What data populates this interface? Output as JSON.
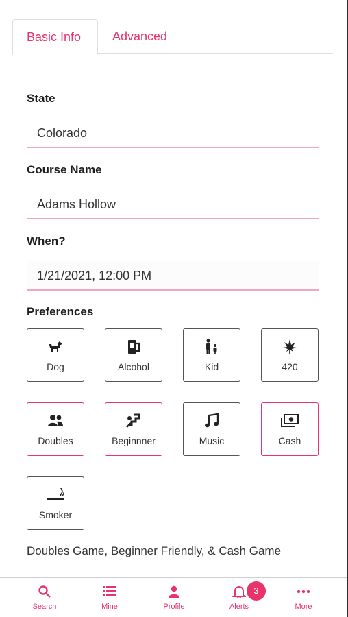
{
  "tabs": [
    {
      "label": "Basic Info",
      "active": true
    },
    {
      "label": "Advanced",
      "active": false
    }
  ],
  "form": {
    "state": {
      "label": "State",
      "value": "Colorado"
    },
    "course": {
      "label": "Course Name",
      "value": "Adams Hollow"
    },
    "when": {
      "label": "When?",
      "value": "1/21/2021, 12:00 PM"
    }
  },
  "preferences": {
    "label": "Preferences",
    "items": [
      {
        "label": "Dog",
        "icon": "dog-icon",
        "selected": false
      },
      {
        "label": "Alcohol",
        "icon": "alcohol-icon",
        "selected": false
      },
      {
        "label": "Kid",
        "icon": "kid-icon",
        "selected": false
      },
      {
        "label": "420",
        "icon": "cannabis-leaf-icon",
        "selected": false
      },
      {
        "label": "Doubles",
        "icon": "doubles-icon",
        "selected": true
      },
      {
        "label": "Beginnner",
        "icon": "beginner-icon",
        "selected": true
      },
      {
        "label": "Music",
        "icon": "music-icon",
        "selected": false
      },
      {
        "label": "Cash",
        "icon": "cash-icon",
        "selected": true
      },
      {
        "label": "Smoker",
        "icon": "smoking-icon",
        "selected": false
      }
    ],
    "summary": "Doubles Game, Beginner Friendly, & Cash Game"
  },
  "bottom_nav": [
    {
      "label": "Search",
      "icon": "search-icon"
    },
    {
      "label": "Mine",
      "icon": "list-icon"
    },
    {
      "label": "Profile",
      "icon": "person-icon"
    },
    {
      "label": "Alerts",
      "icon": "bell-icon",
      "badge": "3"
    },
    {
      "label": "More",
      "icon": "more-icon"
    }
  ],
  "colors": {
    "accent": "#e8336b",
    "field_underline": "#f3a6c0",
    "tile_border": "#555555"
  }
}
